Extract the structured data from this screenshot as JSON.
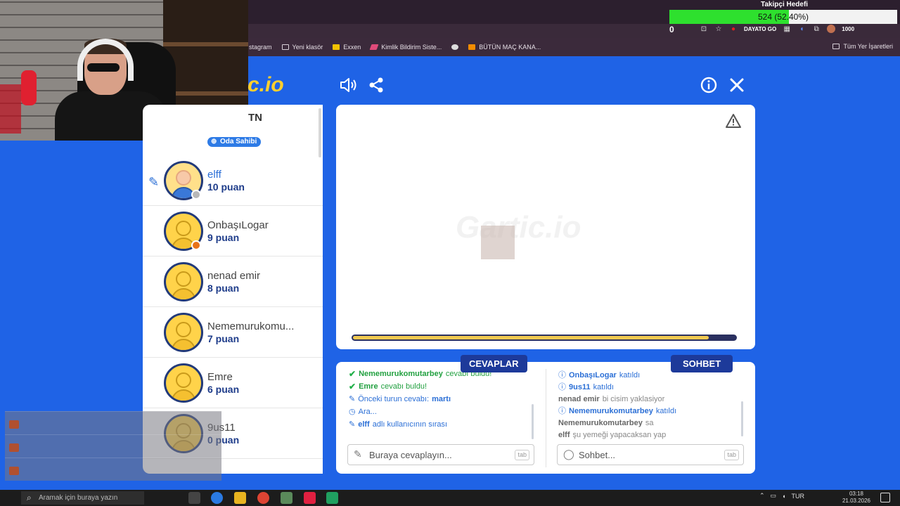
{
  "browser": {
    "bookmarks": [
      "stagram",
      "Yeni klasör",
      "Exxen",
      "Kimlik Bildirim Siste...",
      "",
      "BÜTÜN MAÇ KANA..."
    ],
    "all_bookmarks": "Tüm Yer İşaretleri",
    "extension_label": "DAYATO GO",
    "counter_label": "1000"
  },
  "overlay": {
    "goal_title": "Takipçi Hedefi",
    "goal_text": "524 (52.40%)",
    "goal_progress": 0.524,
    "goal_count": "0"
  },
  "game": {
    "logo": "c.io",
    "room_name": "TN",
    "owner_badge": "Oda Sahibi",
    "players": [
      {
        "name": "elff",
        "score": "10 puan",
        "active": true,
        "avatar": "girl",
        "status": "#b8b8b8"
      },
      {
        "name": "OnbaşıLogar",
        "score": "9 puan",
        "active": false,
        "avatar": "default",
        "status": "#e8731a"
      },
      {
        "name": "nenad emir",
        "score": "8 puan",
        "active": false,
        "avatar": "default",
        "status": ""
      },
      {
        "name": "Nememurukomu...",
        "score": "7 puan",
        "active": false,
        "avatar": "default",
        "status": ""
      },
      {
        "name": "Emre",
        "score": "6 puan",
        "active": false,
        "avatar": "default",
        "status": ""
      },
      {
        "name": "9us11",
        "score": "0 puan",
        "active": false,
        "avatar": "default",
        "status": ""
      }
    ],
    "watermark": "Gartic.io",
    "timer_progress": 0.93,
    "answers_tab": "CEVAPLAR",
    "chat_tab": "SOHBET",
    "answers_feed": [
      {
        "icon": "check",
        "bold": "Nememurukomutarbey",
        "text": "cevabı buldu!",
        "color": "green"
      },
      {
        "icon": "check",
        "bold": "Emre",
        "text": "cevabı buldu!",
        "color": "green"
      },
      {
        "icon": "pen",
        "text": "Önceki turun cevabı:",
        "bold_after": "martı",
        "color": "blue"
      },
      {
        "icon": "clock",
        "text": "Ara...",
        "color": "blue"
      },
      {
        "icon": "pen",
        "bold": "elff",
        "text": "adlı kullanıcının sırası",
        "color": "blue"
      }
    ],
    "chat_feed": [
      {
        "icon": "info",
        "bold": "OnbaşıLogar",
        "text": "katıldı",
        "color": "blue"
      },
      {
        "icon": "info",
        "bold": "9us11",
        "text": "katıldı",
        "color": "blue"
      },
      {
        "bold": "nenad emir",
        "text": "bi cisim yaklasiyor",
        "color": "grey"
      },
      {
        "icon": "info",
        "bold": "Nememurukomutarbey",
        "text": "katıldı",
        "color": "blue"
      },
      {
        "bold": "Nememurukomutarbey",
        "text": "sa",
        "color": "grey"
      },
      {
        "bold": "elff",
        "text": "şu yemeği yapacaksan yap",
        "color": "grey"
      }
    ],
    "answer_placeholder": "Buraya cevaplayın...",
    "chat_placeholder": "Sohbet...",
    "tab_hint": "tab"
  },
  "taskbar": {
    "search_placeholder": "Aramak için buraya yazın",
    "lang": "TUR",
    "time": "03:18",
    "date": "21.03.2026"
  }
}
